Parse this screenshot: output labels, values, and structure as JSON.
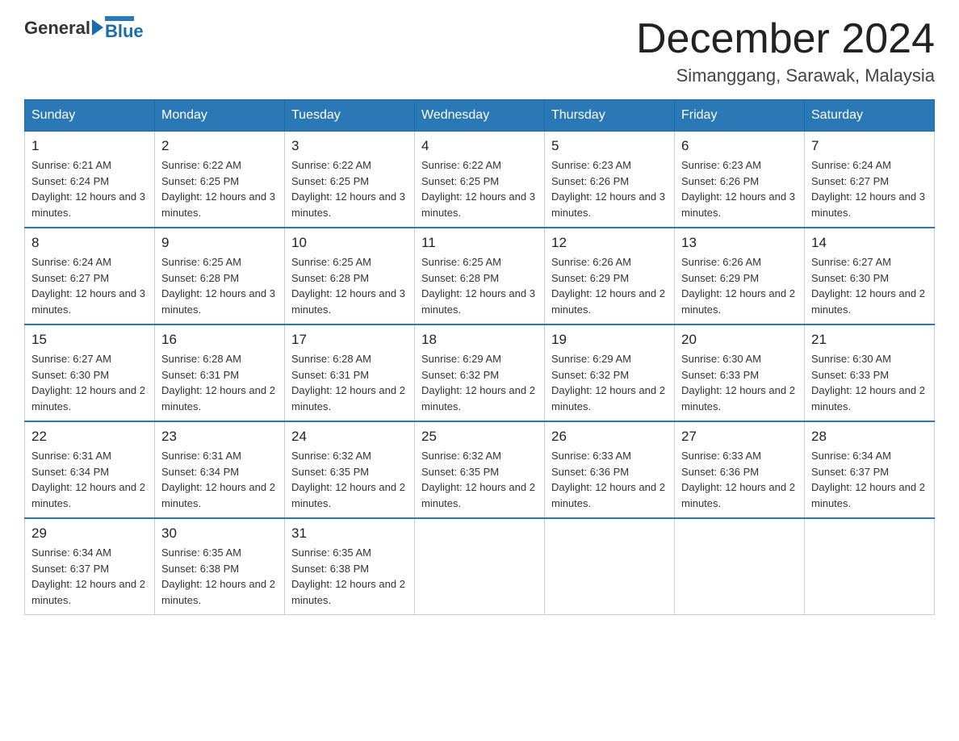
{
  "logo": {
    "text_general": "General",
    "text_blue": "Blue"
  },
  "header": {
    "month": "December 2024",
    "location": "Simanggang, Sarawak, Malaysia"
  },
  "days_of_week": [
    "Sunday",
    "Monday",
    "Tuesday",
    "Wednesday",
    "Thursday",
    "Friday",
    "Saturday"
  ],
  "weeks": [
    [
      {
        "day": "1",
        "sunrise": "6:21 AM",
        "sunset": "6:24 PM",
        "daylight": "12 hours and 3 minutes."
      },
      {
        "day": "2",
        "sunrise": "6:22 AM",
        "sunset": "6:25 PM",
        "daylight": "12 hours and 3 minutes."
      },
      {
        "day": "3",
        "sunrise": "6:22 AM",
        "sunset": "6:25 PM",
        "daylight": "12 hours and 3 minutes."
      },
      {
        "day": "4",
        "sunrise": "6:22 AM",
        "sunset": "6:25 PM",
        "daylight": "12 hours and 3 minutes."
      },
      {
        "day": "5",
        "sunrise": "6:23 AM",
        "sunset": "6:26 PM",
        "daylight": "12 hours and 3 minutes."
      },
      {
        "day": "6",
        "sunrise": "6:23 AM",
        "sunset": "6:26 PM",
        "daylight": "12 hours and 3 minutes."
      },
      {
        "day": "7",
        "sunrise": "6:24 AM",
        "sunset": "6:27 PM",
        "daylight": "12 hours and 3 minutes."
      }
    ],
    [
      {
        "day": "8",
        "sunrise": "6:24 AM",
        "sunset": "6:27 PM",
        "daylight": "12 hours and 3 minutes."
      },
      {
        "day": "9",
        "sunrise": "6:25 AM",
        "sunset": "6:28 PM",
        "daylight": "12 hours and 3 minutes."
      },
      {
        "day": "10",
        "sunrise": "6:25 AM",
        "sunset": "6:28 PM",
        "daylight": "12 hours and 3 minutes."
      },
      {
        "day": "11",
        "sunrise": "6:25 AM",
        "sunset": "6:28 PM",
        "daylight": "12 hours and 3 minutes."
      },
      {
        "day": "12",
        "sunrise": "6:26 AM",
        "sunset": "6:29 PM",
        "daylight": "12 hours and 2 minutes."
      },
      {
        "day": "13",
        "sunrise": "6:26 AM",
        "sunset": "6:29 PM",
        "daylight": "12 hours and 2 minutes."
      },
      {
        "day": "14",
        "sunrise": "6:27 AM",
        "sunset": "6:30 PM",
        "daylight": "12 hours and 2 minutes."
      }
    ],
    [
      {
        "day": "15",
        "sunrise": "6:27 AM",
        "sunset": "6:30 PM",
        "daylight": "12 hours and 2 minutes."
      },
      {
        "day": "16",
        "sunrise": "6:28 AM",
        "sunset": "6:31 PM",
        "daylight": "12 hours and 2 minutes."
      },
      {
        "day": "17",
        "sunrise": "6:28 AM",
        "sunset": "6:31 PM",
        "daylight": "12 hours and 2 minutes."
      },
      {
        "day": "18",
        "sunrise": "6:29 AM",
        "sunset": "6:32 PM",
        "daylight": "12 hours and 2 minutes."
      },
      {
        "day": "19",
        "sunrise": "6:29 AM",
        "sunset": "6:32 PM",
        "daylight": "12 hours and 2 minutes."
      },
      {
        "day": "20",
        "sunrise": "6:30 AM",
        "sunset": "6:33 PM",
        "daylight": "12 hours and 2 minutes."
      },
      {
        "day": "21",
        "sunrise": "6:30 AM",
        "sunset": "6:33 PM",
        "daylight": "12 hours and 2 minutes."
      }
    ],
    [
      {
        "day": "22",
        "sunrise": "6:31 AM",
        "sunset": "6:34 PM",
        "daylight": "12 hours and 2 minutes."
      },
      {
        "day": "23",
        "sunrise": "6:31 AM",
        "sunset": "6:34 PM",
        "daylight": "12 hours and 2 minutes."
      },
      {
        "day": "24",
        "sunrise": "6:32 AM",
        "sunset": "6:35 PM",
        "daylight": "12 hours and 2 minutes."
      },
      {
        "day": "25",
        "sunrise": "6:32 AM",
        "sunset": "6:35 PM",
        "daylight": "12 hours and 2 minutes."
      },
      {
        "day": "26",
        "sunrise": "6:33 AM",
        "sunset": "6:36 PM",
        "daylight": "12 hours and 2 minutes."
      },
      {
        "day": "27",
        "sunrise": "6:33 AM",
        "sunset": "6:36 PM",
        "daylight": "12 hours and 2 minutes."
      },
      {
        "day": "28",
        "sunrise": "6:34 AM",
        "sunset": "6:37 PM",
        "daylight": "12 hours and 2 minutes."
      }
    ],
    [
      {
        "day": "29",
        "sunrise": "6:34 AM",
        "sunset": "6:37 PM",
        "daylight": "12 hours and 2 minutes."
      },
      {
        "day": "30",
        "sunrise": "6:35 AM",
        "sunset": "6:38 PM",
        "daylight": "12 hours and 2 minutes."
      },
      {
        "day": "31",
        "sunrise": "6:35 AM",
        "sunset": "6:38 PM",
        "daylight": "12 hours and 2 minutes."
      },
      null,
      null,
      null,
      null
    ]
  ],
  "labels": {
    "sunrise": "Sunrise:",
    "sunset": "Sunset:",
    "daylight": "Daylight:"
  }
}
